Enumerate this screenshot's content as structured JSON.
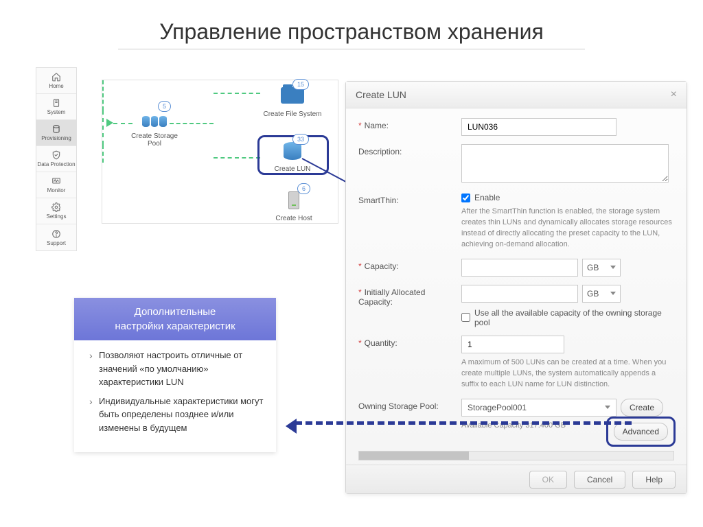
{
  "page": {
    "title": "Управление пространством хранения"
  },
  "sidebar": {
    "items": [
      {
        "label": "Home"
      },
      {
        "label": "System"
      },
      {
        "label": "Provisioning"
      },
      {
        "label": "Data Protection"
      },
      {
        "label": "Monitor"
      },
      {
        "label": "Settings"
      },
      {
        "label": "Support"
      }
    ]
  },
  "workflow": {
    "storage_pool": {
      "label": "Create Storage Pool",
      "badge": "5"
    },
    "file_system": {
      "label": "Create File System",
      "badge": "15"
    },
    "lun": {
      "label": "Create LUN",
      "badge": "33"
    },
    "host": {
      "label": "Create Host",
      "badge": "6"
    }
  },
  "dialog": {
    "title": "Create LUN",
    "name_label": "Name:",
    "name_value": "LUN036",
    "description_label": "Description:",
    "description_value": "",
    "smartthin_label": "SmartThin:",
    "smartthin_enable": "Enable",
    "smartthin_help": "After the SmartThin function is enabled, the storage system creates thin LUNs and dynamically allocates storage resources instead of directly allocating the preset capacity to the LUN, achieving on-demand allocation.",
    "capacity_label": "Capacity:",
    "capacity_unit": "GB",
    "initial_capacity_label": "Initially Allocated Capacity:",
    "initial_capacity_unit": "GB",
    "use_all_label": "Use all the available capacity of the owning storage pool",
    "quantity_label": "Quantity:",
    "quantity_value": "1",
    "quantity_help": "A maximum of 500 LUNs can be created at a time. When you create multiple LUNs, the system automatically appends a suffix to each LUN name for LUN distinction.",
    "owning_pool_label": "Owning Storage Pool:",
    "owning_pool_value": "StoragePool001",
    "create_button": "Create",
    "available_capacity": "Available Capacity 317.400 GB",
    "advanced": "Advanced",
    "ok": "OK",
    "cancel": "Cancel",
    "help": "Help"
  },
  "callout": {
    "header_line1": "Дополнительные",
    "header_line2": "настройки характеристик",
    "items": [
      "Позволяют  настроить отличные от значений «по умолчанию» характеристики LUN",
      "Индивидуальные характеристики могут быть определены позднее и/или изменены в будущем"
    ]
  }
}
